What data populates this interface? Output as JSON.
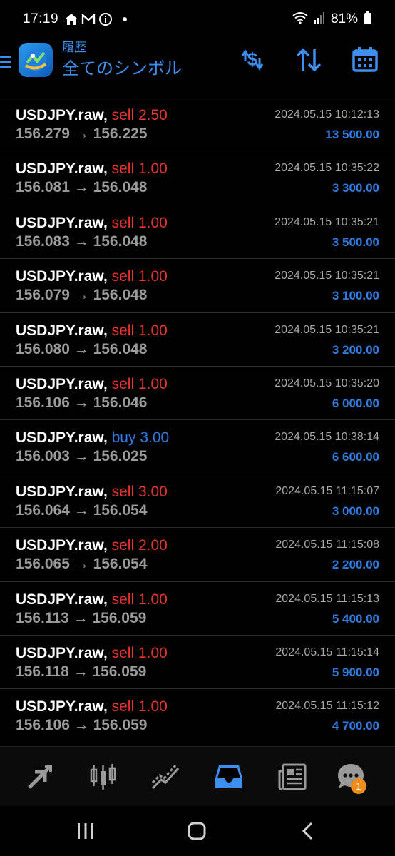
{
  "status_bar": {
    "time": "17:19",
    "battery": "81%"
  },
  "header": {
    "subtitle": "履歴",
    "title": "全てのシンボル"
  },
  "trades": [
    {
      "symbol": "USDJPY.raw,",
      "side": "sell",
      "volume": "2.50",
      "prices": "156.279 → 156.225",
      "time": "2024.05.15 10:12:13",
      "profit": "13 500.00"
    },
    {
      "symbol": "USDJPY.raw,",
      "side": "sell",
      "volume": "1.00",
      "prices": "156.081 → 156.048",
      "time": "2024.05.15 10:35:22",
      "profit": "3 300.00"
    },
    {
      "symbol": "USDJPY.raw,",
      "side": "sell",
      "volume": "1.00",
      "prices": "156.083 → 156.048",
      "time": "2024.05.15 10:35:21",
      "profit": "3 500.00"
    },
    {
      "symbol": "USDJPY.raw,",
      "side": "sell",
      "volume": "1.00",
      "prices": "156.079 → 156.048",
      "time": "2024.05.15 10:35:21",
      "profit": "3 100.00"
    },
    {
      "symbol": "USDJPY.raw,",
      "side": "sell",
      "volume": "1.00",
      "prices": "156.080 → 156.048",
      "time": "2024.05.15 10:35:21",
      "profit": "3 200.00"
    },
    {
      "symbol": "USDJPY.raw,",
      "side": "sell",
      "volume": "1.00",
      "prices": "156.106 → 156.046",
      "time": "2024.05.15 10:35:20",
      "profit": "6 000.00"
    },
    {
      "symbol": "USDJPY.raw,",
      "side": "buy",
      "volume": "3.00",
      "prices": "156.003 → 156.025",
      "time": "2024.05.15 10:38:14",
      "profit": "6 600.00"
    },
    {
      "symbol": "USDJPY.raw,",
      "side": "sell",
      "volume": "3.00",
      "prices": "156.064 → 156.054",
      "time": "2024.05.15 11:15:07",
      "profit": "3 000.00"
    },
    {
      "symbol": "USDJPY.raw,",
      "side": "sell",
      "volume": "2.00",
      "prices": "156.065 → 156.054",
      "time": "2024.05.15 11:15:08",
      "profit": "2 200.00"
    },
    {
      "symbol": "USDJPY.raw,",
      "side": "sell",
      "volume": "1.00",
      "prices": "156.113 → 156.059",
      "time": "2024.05.15 11:15:13",
      "profit": "5 400.00"
    },
    {
      "symbol": "USDJPY.raw,",
      "side": "sell",
      "volume": "1.00",
      "prices": "156.118 → 156.059",
      "time": "2024.05.15 11:15:14",
      "profit": "5 900.00"
    },
    {
      "symbol": "USDJPY.raw,",
      "side": "sell",
      "volume": "1.00",
      "prices": "156.106 → 156.059",
      "time": "2024.05.15 11:15:12",
      "profit": "4 700.00"
    }
  ],
  "bottom_nav": {
    "items": [
      {
        "icon": "quotes-arrows-icon",
        "active": false
      },
      {
        "icon": "candlestick-chart-icon",
        "active": false
      },
      {
        "icon": "trade-line-icon",
        "active": false
      },
      {
        "icon": "history-inbox-icon",
        "active": true
      },
      {
        "icon": "news-icon",
        "active": false
      },
      {
        "icon": "chat-icon",
        "active": false,
        "badge": "1"
      }
    ]
  },
  "colors": {
    "accent": "#3d8fef",
    "sell": "#e8332e",
    "buy": "#2f7de0",
    "muted": "#9a9a9a",
    "badge": "#f08c1a"
  }
}
